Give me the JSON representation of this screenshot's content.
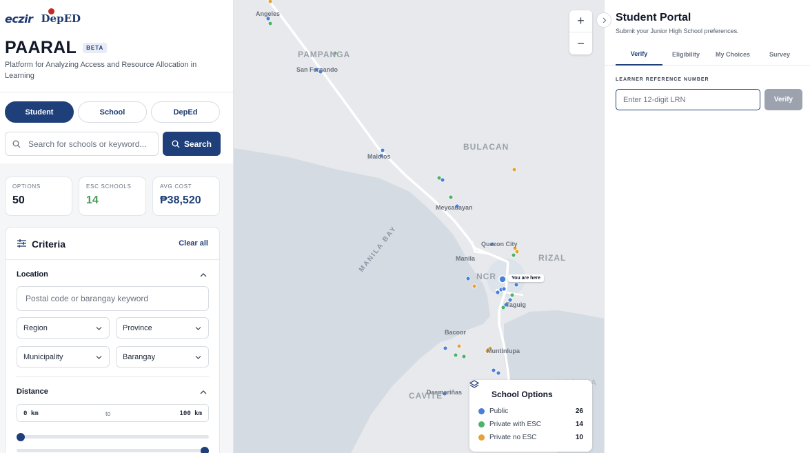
{
  "header": {
    "logo_eczir": "eczir",
    "logo_deped": "DepED",
    "title": "PAARAL",
    "badge": "BETA",
    "tagline": "Platform for Analyzing Access and Resource Allocation in Learning"
  },
  "roles": [
    {
      "label": "Student",
      "active": true
    },
    {
      "label": "School",
      "active": false
    },
    {
      "label": "DepEd",
      "active": false
    }
  ],
  "search": {
    "placeholder": "Search for schools or keyword...",
    "button_label": "Search",
    "icon": "search-icon"
  },
  "stats": [
    {
      "label": "OPTIONS",
      "value": "50"
    },
    {
      "label": "ESC SCHOOLS",
      "value": "14"
    },
    {
      "label": "AVG COST",
      "value": "₱38,520"
    }
  ],
  "criteria": {
    "title": "Criteria",
    "clear_label": "Clear all",
    "location": {
      "title": "Location",
      "postal_placeholder": "Postal code or barangay keyword",
      "selects": [
        "Region",
        "Province",
        "Municipality",
        "Barangay"
      ]
    },
    "distance": {
      "title": "Distance",
      "min": "0 km",
      "to": "to",
      "max": "100 km",
      "min_fraction": 0,
      "max_fraction": 1
    }
  },
  "map": {
    "places": [
      "Angeles",
      "San Fernando",
      "Malolos",
      "Meycauayan",
      "Quezon City",
      "Manila",
      "Taguig",
      "Bacoor",
      "Muntinlupa",
      "Dasmariñas"
    ],
    "regions": [
      "PAMPANGA",
      "BULACAN",
      "RIZAL",
      "NCR",
      "CAVITE",
      "LAGUNA"
    ],
    "bay": "MANILA BAY",
    "you_are_here": "You are here",
    "zoom_in": "+",
    "zoom_out": "−"
  },
  "legend": {
    "title": "School Options",
    "items": [
      {
        "label": "Public",
        "count": "26",
        "color": "#4a7fd8"
      },
      {
        "label": "Private with ESC",
        "count": "14",
        "color": "#4bb36a"
      },
      {
        "label": "Private no ESC",
        "count": "10",
        "color": "#e5a33a"
      }
    ]
  },
  "portal": {
    "title": "Student Portal",
    "subtitle": "Submit your Junior High School preferences.",
    "tabs": [
      "Verify",
      "Eligibility",
      "My Choices",
      "Survey"
    ],
    "active_tab": "Verify",
    "lrn_label": "LEARNER REFERENCE NUMBER",
    "lrn_placeholder": "Enter 12-digit LRN",
    "verify_label": "Verify"
  },
  "colors": {
    "primary": "#1e3f7a",
    "public": "#4a7fd8",
    "private_esc": "#4bb36a",
    "private_no_esc": "#e5a33a"
  }
}
